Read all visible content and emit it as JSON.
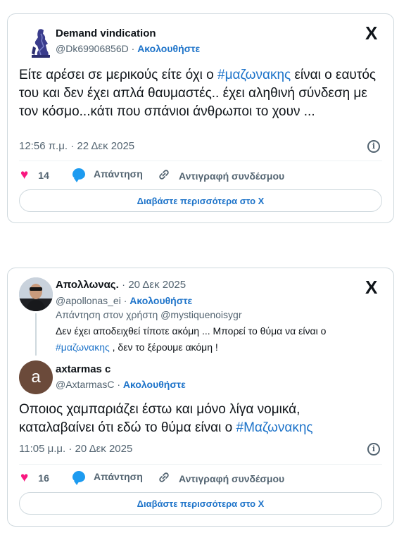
{
  "tweet1": {
    "author_name": "Demand vindication",
    "handle": "@Dk69906856D",
    "follow_label": "Ακολουθήστε",
    "text_before": "Είτε αρέσει σε μερικούς είτε όχι ο ",
    "hashtag": "#μαζωνακης",
    "text_after": " είναι ο εαυτός του και δεν έχει απλά θαυμαστές..  έχει αληθινή σύνδεση με τον κόσμο...κάτι που σπάνιοι άνθρωποι το χουν ...",
    "timestamp": "12:56 π.μ. · 22 Δεκ 2025",
    "likes": "14",
    "reply_label": "Απάντηση",
    "copy_link_label": "Αντιγραφή συνδέσμου",
    "read_more_label": "Διαβάστε περισσότερα στο X"
  },
  "tweet2": {
    "parent": {
      "author_name": "Απολλωνας.",
      "date": "20 Δεκ 2025",
      "handle": "@apollonas_ei",
      "follow_label": "Ακολουθήστε",
      "replying_to": "Απάντηση στον χρήστη @mystiquenoisygr",
      "text_before": "Δεν έχει αποδειχθεί τίποτε ακόμη ... Μπορεί το θύμα να είναι ο ",
      "hashtag": "#μαζωνακης",
      "text_after": " , δεν το ξέρουμε ακόμη !"
    },
    "author_name": "axtarmas c",
    "avatar_letter": "a",
    "handle": "@AxtarmasC",
    "follow_label": "Ακολουθήστε",
    "text_before": "Οποιος  χαμπαριάζει έστω και μόνο λίγα νομικά, καταλαβαίνει ότι εδώ το θύμα είναι ο ",
    "hashtag": "#Μαζωνακης",
    "timestamp": "11:05 μ.μ. · 20 Δεκ 2025",
    "likes": "16",
    "reply_label": "Απάντηση",
    "copy_link_label": "Αντιγραφή συνδέσμου",
    "read_more_label": "Διαβάστε περισσότερα στο X"
  },
  "icons": {
    "x_logo": "X",
    "separator": "·",
    "info": "i",
    "heart": "♥",
    "link": "🔗"
  },
  "colors": {
    "accent": "#1d73c9",
    "heart": "#f91880",
    "reply_bubble": "#1d9bf0",
    "avatar_bg": "#6b4a3a"
  }
}
